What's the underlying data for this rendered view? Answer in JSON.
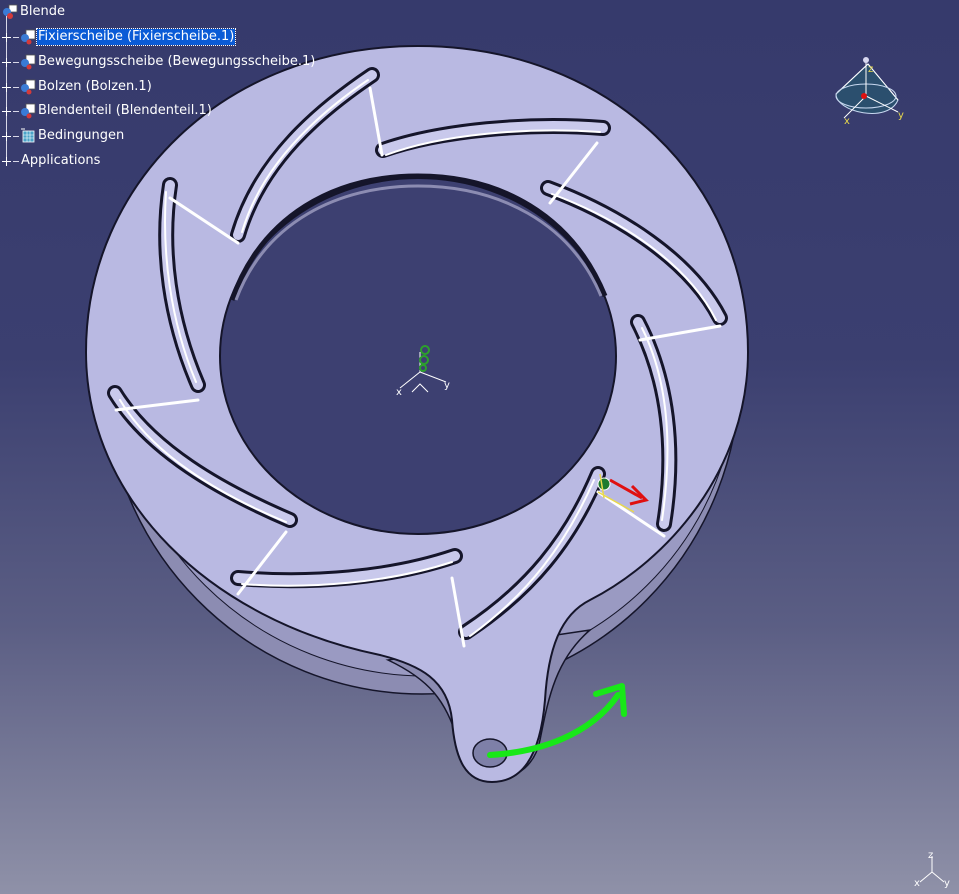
{
  "tree": {
    "root": {
      "label": "Blende",
      "icon": "product-icon"
    },
    "items": [
      {
        "label": "Fixierscheibe (Fixierscheibe.1)",
        "icon": "part-icon",
        "selected": true
      },
      {
        "label": "Bewegungsscheibe (Bewegungsscheibe.1)",
        "icon": "part-icon",
        "selected": false
      },
      {
        "label": "Bolzen (Bolzen.1)",
        "icon": "part-icon",
        "selected": false
      },
      {
        "label": "Blendenteil (Blendenteil.1)",
        "icon": "part-icon",
        "selected": false
      },
      {
        "label": "Bedingungen",
        "icon": "constraints-icon",
        "selected": false
      },
      {
        "label": "Applications",
        "icon": null,
        "selected": false
      }
    ]
  },
  "compass": {
    "axis_x": "x",
    "axis_y": "y",
    "axis_z": "z"
  },
  "mini_axis": {
    "axis_x": "x",
    "axis_y": "y",
    "axis_z": "z"
  },
  "origin_axes": {
    "axis_x": "x",
    "axis_y": "y"
  },
  "colors": {
    "background_top": "#363a6c",
    "background_bottom": "#8f91a8",
    "part_face": "#b9b9e2",
    "part_edge": "#15152a",
    "selection": "#0a5bd6",
    "rotation_arrow": "#18e818",
    "drag_arrow": "#e01010"
  },
  "annotation": {
    "rotation_arrow_icon": "curved-arrow-icon"
  }
}
